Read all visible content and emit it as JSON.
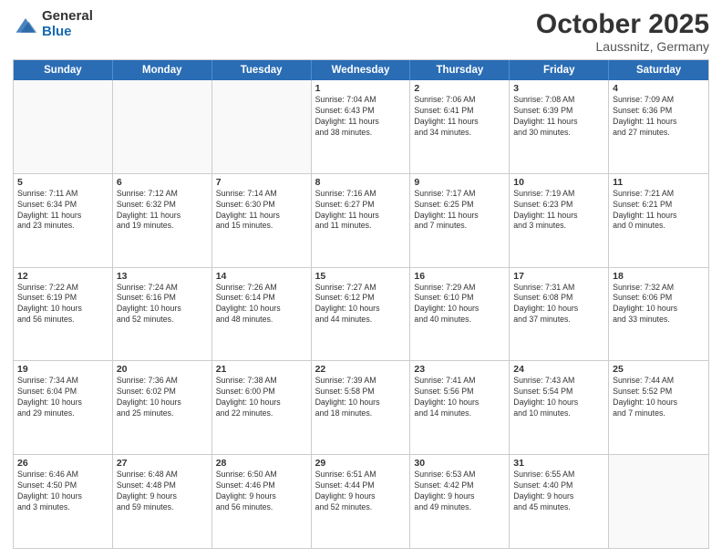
{
  "header": {
    "logo_general": "General",
    "logo_blue": "Blue",
    "month_title": "October 2025",
    "location": "Laussnitz, Germany"
  },
  "days_of_week": [
    "Sunday",
    "Monday",
    "Tuesday",
    "Wednesday",
    "Thursday",
    "Friday",
    "Saturday"
  ],
  "weeks": [
    [
      {
        "day": "",
        "info": ""
      },
      {
        "day": "",
        "info": ""
      },
      {
        "day": "",
        "info": ""
      },
      {
        "day": "1",
        "info": "Sunrise: 7:04 AM\nSunset: 6:43 PM\nDaylight: 11 hours\nand 38 minutes."
      },
      {
        "day": "2",
        "info": "Sunrise: 7:06 AM\nSunset: 6:41 PM\nDaylight: 11 hours\nand 34 minutes."
      },
      {
        "day": "3",
        "info": "Sunrise: 7:08 AM\nSunset: 6:39 PM\nDaylight: 11 hours\nand 30 minutes."
      },
      {
        "day": "4",
        "info": "Sunrise: 7:09 AM\nSunset: 6:36 PM\nDaylight: 11 hours\nand 27 minutes."
      }
    ],
    [
      {
        "day": "5",
        "info": "Sunrise: 7:11 AM\nSunset: 6:34 PM\nDaylight: 11 hours\nand 23 minutes."
      },
      {
        "day": "6",
        "info": "Sunrise: 7:12 AM\nSunset: 6:32 PM\nDaylight: 11 hours\nand 19 minutes."
      },
      {
        "day": "7",
        "info": "Sunrise: 7:14 AM\nSunset: 6:30 PM\nDaylight: 11 hours\nand 15 minutes."
      },
      {
        "day": "8",
        "info": "Sunrise: 7:16 AM\nSunset: 6:27 PM\nDaylight: 11 hours\nand 11 minutes."
      },
      {
        "day": "9",
        "info": "Sunrise: 7:17 AM\nSunset: 6:25 PM\nDaylight: 11 hours\nand 7 minutes."
      },
      {
        "day": "10",
        "info": "Sunrise: 7:19 AM\nSunset: 6:23 PM\nDaylight: 11 hours\nand 3 minutes."
      },
      {
        "day": "11",
        "info": "Sunrise: 7:21 AM\nSunset: 6:21 PM\nDaylight: 11 hours\nand 0 minutes."
      }
    ],
    [
      {
        "day": "12",
        "info": "Sunrise: 7:22 AM\nSunset: 6:19 PM\nDaylight: 10 hours\nand 56 minutes."
      },
      {
        "day": "13",
        "info": "Sunrise: 7:24 AM\nSunset: 6:16 PM\nDaylight: 10 hours\nand 52 minutes."
      },
      {
        "day": "14",
        "info": "Sunrise: 7:26 AM\nSunset: 6:14 PM\nDaylight: 10 hours\nand 48 minutes."
      },
      {
        "day": "15",
        "info": "Sunrise: 7:27 AM\nSunset: 6:12 PM\nDaylight: 10 hours\nand 44 minutes."
      },
      {
        "day": "16",
        "info": "Sunrise: 7:29 AM\nSunset: 6:10 PM\nDaylight: 10 hours\nand 40 minutes."
      },
      {
        "day": "17",
        "info": "Sunrise: 7:31 AM\nSunset: 6:08 PM\nDaylight: 10 hours\nand 37 minutes."
      },
      {
        "day": "18",
        "info": "Sunrise: 7:32 AM\nSunset: 6:06 PM\nDaylight: 10 hours\nand 33 minutes."
      }
    ],
    [
      {
        "day": "19",
        "info": "Sunrise: 7:34 AM\nSunset: 6:04 PM\nDaylight: 10 hours\nand 29 minutes."
      },
      {
        "day": "20",
        "info": "Sunrise: 7:36 AM\nSunset: 6:02 PM\nDaylight: 10 hours\nand 25 minutes."
      },
      {
        "day": "21",
        "info": "Sunrise: 7:38 AM\nSunset: 6:00 PM\nDaylight: 10 hours\nand 22 minutes."
      },
      {
        "day": "22",
        "info": "Sunrise: 7:39 AM\nSunset: 5:58 PM\nDaylight: 10 hours\nand 18 minutes."
      },
      {
        "day": "23",
        "info": "Sunrise: 7:41 AM\nSunset: 5:56 PM\nDaylight: 10 hours\nand 14 minutes."
      },
      {
        "day": "24",
        "info": "Sunrise: 7:43 AM\nSunset: 5:54 PM\nDaylight: 10 hours\nand 10 minutes."
      },
      {
        "day": "25",
        "info": "Sunrise: 7:44 AM\nSunset: 5:52 PM\nDaylight: 10 hours\nand 7 minutes."
      }
    ],
    [
      {
        "day": "26",
        "info": "Sunrise: 6:46 AM\nSunset: 4:50 PM\nDaylight: 10 hours\nand 3 minutes."
      },
      {
        "day": "27",
        "info": "Sunrise: 6:48 AM\nSunset: 4:48 PM\nDaylight: 9 hours\nand 59 minutes."
      },
      {
        "day": "28",
        "info": "Sunrise: 6:50 AM\nSunset: 4:46 PM\nDaylight: 9 hours\nand 56 minutes."
      },
      {
        "day": "29",
        "info": "Sunrise: 6:51 AM\nSunset: 4:44 PM\nDaylight: 9 hours\nand 52 minutes."
      },
      {
        "day": "30",
        "info": "Sunrise: 6:53 AM\nSunset: 4:42 PM\nDaylight: 9 hours\nand 49 minutes."
      },
      {
        "day": "31",
        "info": "Sunrise: 6:55 AM\nSunset: 4:40 PM\nDaylight: 9 hours\nand 45 minutes."
      },
      {
        "day": "",
        "info": ""
      }
    ]
  ]
}
